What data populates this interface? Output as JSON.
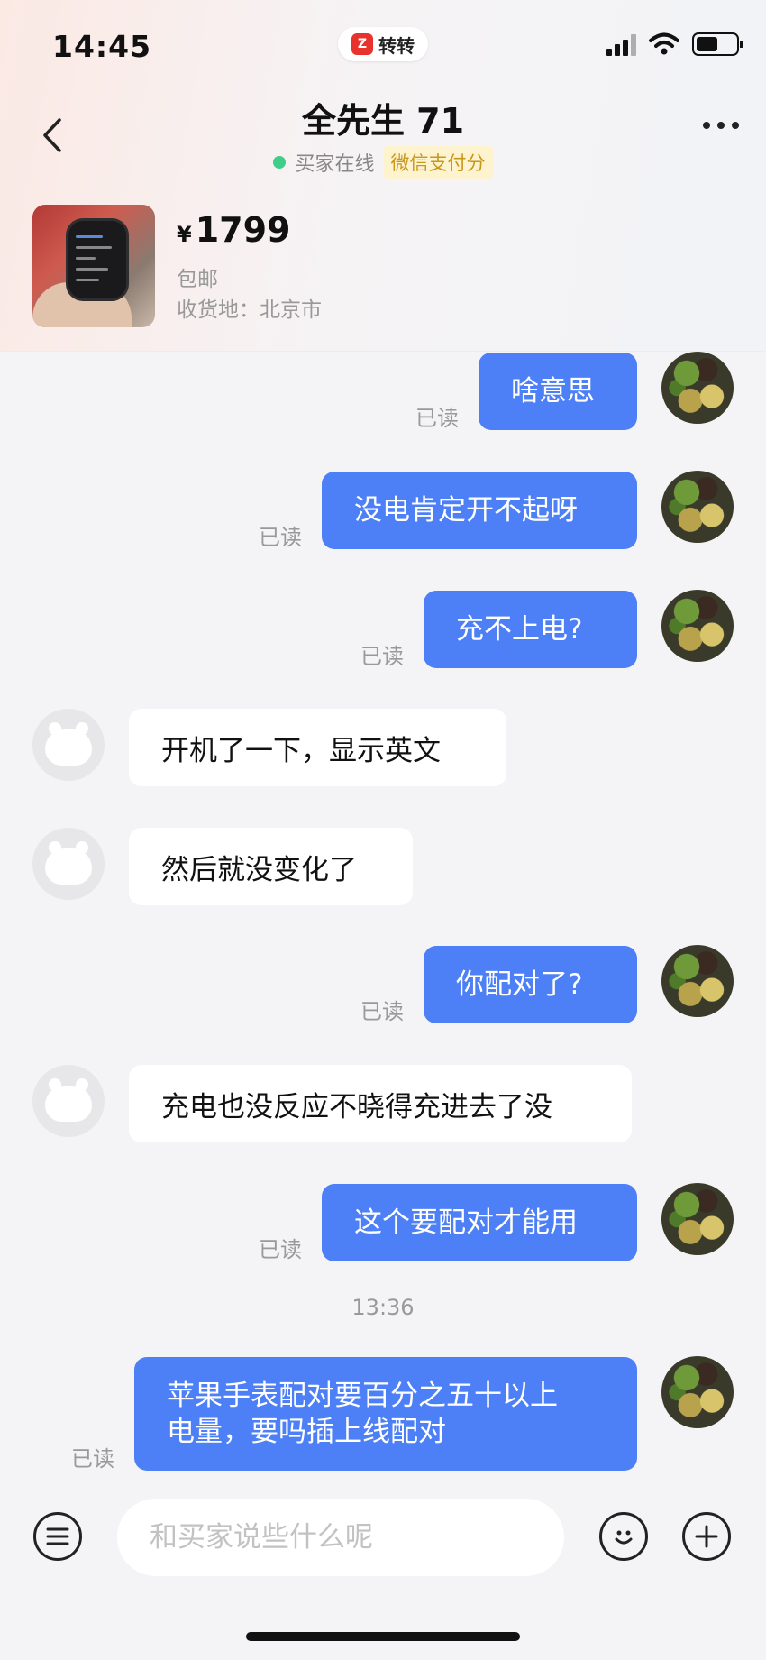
{
  "status_bar": {
    "time": "14:45",
    "app_pill_label": "转转",
    "app_logo_glyph": "Z"
  },
  "header": {
    "title": "全先生 71",
    "online_text": "买家在线",
    "pay_badge": "微信支付分"
  },
  "product": {
    "currency": "¥",
    "price": "1799",
    "shipping": "包邮",
    "address": "收货地：北京市"
  },
  "messages": [
    {
      "side": "right",
      "text": "啥意思",
      "read": "已读"
    },
    {
      "side": "right",
      "text": "没电肯定开不起呀",
      "read": "已读"
    },
    {
      "side": "right",
      "text": "充不上电?",
      "read": "已读"
    },
    {
      "side": "left",
      "text": "开机了一下，显示英文"
    },
    {
      "side": "left",
      "text": "然后就没变化了"
    },
    {
      "side": "right",
      "text": "你配对了?",
      "read": "已读"
    },
    {
      "side": "left",
      "text": "充电也没反应不晓得充进去了没"
    },
    {
      "side": "right",
      "text": "这个要配对才能用",
      "read": "已读"
    },
    {
      "side": "right",
      "text": "苹果手表配对要百分之五十以上\n电量，要吗插上线配对",
      "read": "已读"
    }
  ],
  "time_separator": "13:36",
  "input": {
    "placeholder": "和买家说些什么呢",
    "value": ""
  },
  "colors": {
    "bubble_right": "#4d80f6",
    "bubble_left": "#ffffff",
    "online": "#3fce8a",
    "pay_badge_text": "#c9971a"
  }
}
